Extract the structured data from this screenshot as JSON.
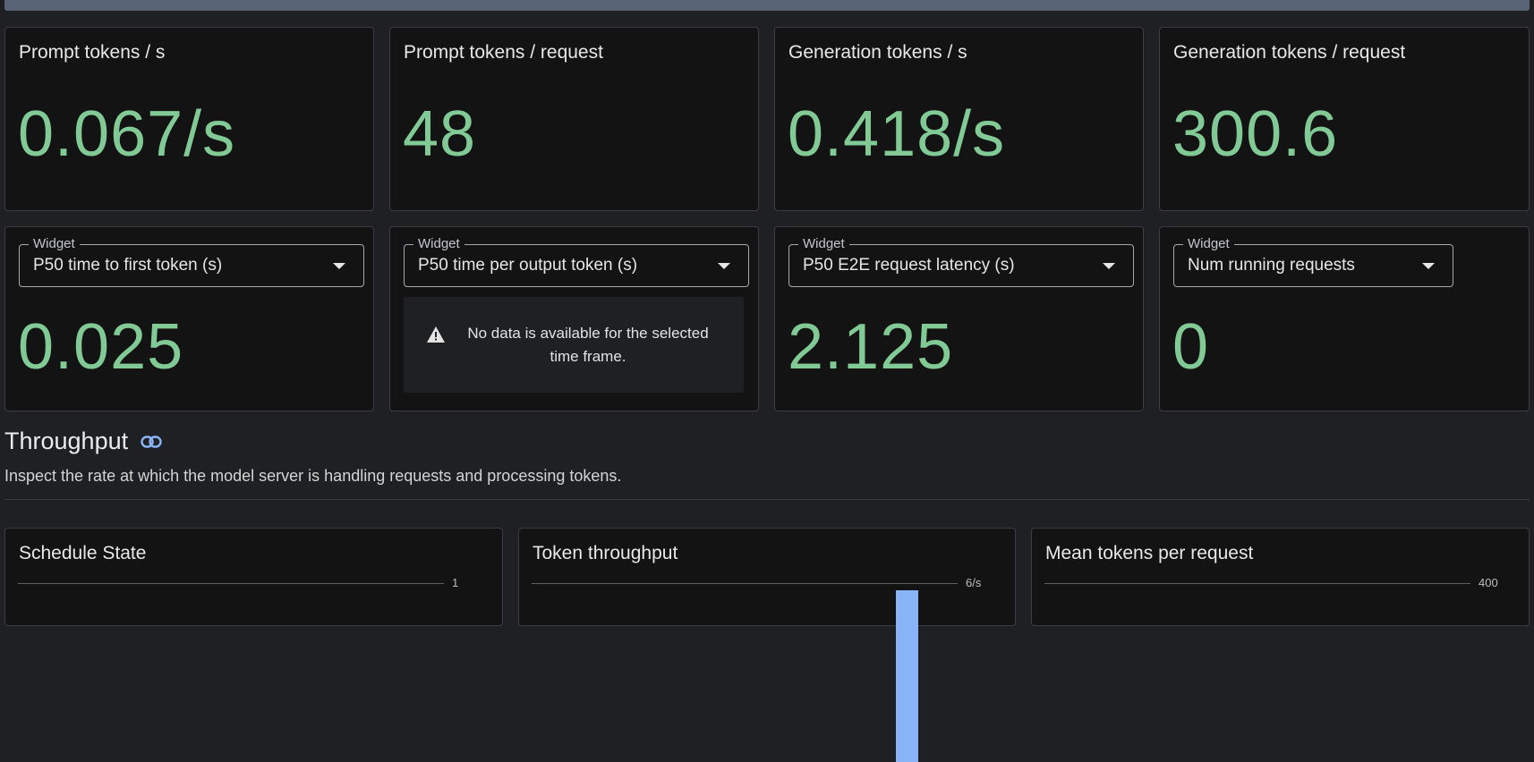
{
  "row1": [
    {
      "title": "Prompt tokens / s",
      "value": "0.067/s"
    },
    {
      "title": "Prompt tokens / request",
      "value": "48"
    },
    {
      "title": "Generation tokens / s",
      "value": "0.418/s"
    },
    {
      "title": "Generation tokens / request",
      "value": "300.6"
    }
  ],
  "row2": [
    {
      "legend": "Widget",
      "selected": "P50 time to first token (s)",
      "value": "0.025"
    },
    {
      "legend": "Widget",
      "selected": "P50 time per output token (s)",
      "nodata": "No data is available for the selected time frame."
    },
    {
      "legend": "Widget",
      "selected": "P50 E2E request latency (s)",
      "value": "2.125"
    },
    {
      "legend": "Widget",
      "selected": "Num running requests",
      "value": "0"
    }
  ],
  "section": {
    "title": "Throughput",
    "description": "Inspect the rate at which the model server is handling requests and processing tokens."
  },
  "charts": [
    {
      "title": "Schedule State",
      "top_tick": "1"
    },
    {
      "title": "Token throughput",
      "top_tick": "6/s",
      "bar_value_fraction": 0.96
    },
    {
      "title": "Mean tokens per request",
      "top_tick": "400"
    }
  ],
  "colors": {
    "value_green": "#81c995",
    "bar_blue": "#8ab4f8",
    "link_icon": "#8ab4f8"
  },
  "icons": {
    "warning": "warning-icon",
    "link": "link-icon",
    "dropdown": "dropdown-arrow-icon"
  }
}
